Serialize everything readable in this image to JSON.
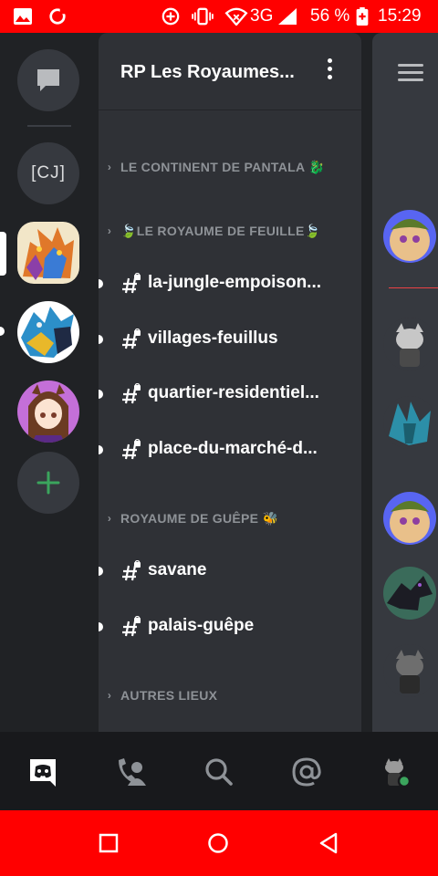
{
  "status_bar": {
    "network": "3G",
    "battery": "56 %",
    "time": "15:29"
  },
  "servers": [
    {
      "name": "direct-messages"
    },
    {
      "label": "[CJ]"
    },
    {
      "name": "rp-les-royaumes",
      "selected": true
    },
    {
      "name": "dragons-server",
      "unread": true
    },
    {
      "name": "anime-avatar-server"
    },
    {
      "name": "add-server"
    }
  ],
  "channel_panel": {
    "server_name": "RP Les Royaumes...",
    "categories": [
      {
        "label": "LE CONTINENT DE PANTALA 🐉"
      },
      {
        "label": "🍃LE ROYAUME DE FEUILLE🍃"
      },
      {
        "label": "ROYAUME DE GUÊPE 🐝"
      },
      {
        "label": "AUTRES LIEUX"
      }
    ],
    "channels": [
      {
        "name": "la-jungle-empoison..."
      },
      {
        "name": "villages-feuillus"
      },
      {
        "name": "quartier-residentiel..."
      },
      {
        "name": "place-du-marché-d..."
      },
      {
        "name": "savane"
      },
      {
        "name": "palais-guêpe"
      }
    ]
  },
  "bottom_nav": [
    "home",
    "friends",
    "search",
    "mentions",
    "profile"
  ],
  "colors": {
    "status_bar": "#ff0000",
    "rail_bg": "#202225",
    "panel_bg": "#2f3136",
    "chat_bg": "#36393f",
    "nav_bg": "#18191c",
    "accent_green": "#3ba55d",
    "muted_text": "#8e9297"
  }
}
